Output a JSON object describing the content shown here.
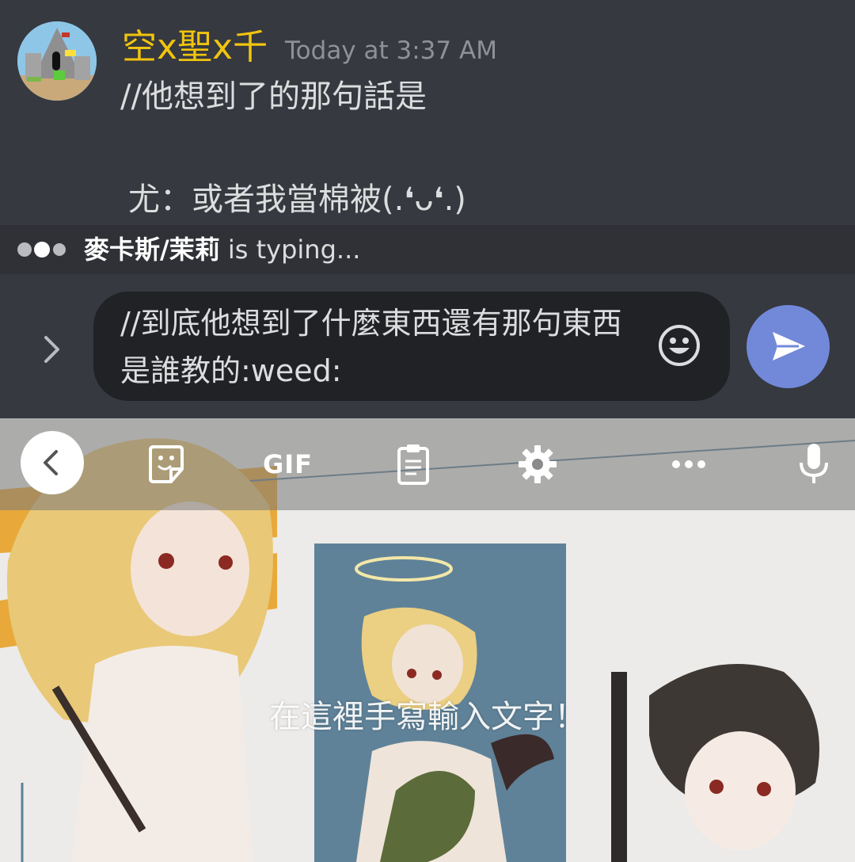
{
  "message": {
    "username": "空x聖x千",
    "timestamp": "Today at 3:37 AM",
    "lines": [
      "//他想到了的那句話是",
      "尤：或者我當棉被(.❛ᴗ❛.)"
    ]
  },
  "typing": {
    "name": "麥卡斯/茉莉",
    "suffix": " is typing..."
  },
  "composer": {
    "input_value": "//到底他想到了什麼東西還有那句東西是誰教的:weed:"
  },
  "keyboard": {
    "gif_label": "GIF",
    "handwriting_hint": "在這裡手寫輸入文字！"
  },
  "colors": {
    "username": "#f1c40f",
    "send_button": "#7289da",
    "chat_background": "#36393f",
    "typing_background": "#2f3136",
    "input_background": "#202225"
  },
  "icons": {
    "expand": "chevron-right-icon",
    "emoji": "smiley-icon",
    "send": "send-arrow-icon",
    "back": "chevron-left-icon",
    "sticker": "sticker-icon",
    "clipboard": "clipboard-icon",
    "settings": "gear-icon",
    "more": "more-dots-icon",
    "voice": "microphone-icon"
  }
}
